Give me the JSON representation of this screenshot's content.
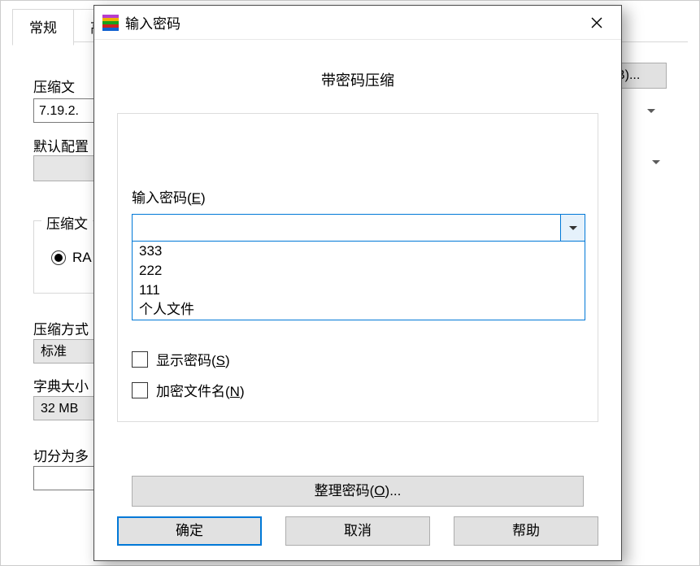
{
  "background": {
    "tabs": {
      "general": "常规",
      "advanced_partial": "高"
    },
    "filename_label": "压缩文",
    "browse_btn": "(B)...",
    "filename_value": "7.19.2.",
    "profile_label": "默认配置",
    "format_group_legend": "压缩文",
    "format_radio_rar": "RA",
    "method_label": "压缩方式",
    "method_value": "标准",
    "dict_label": "字典大小",
    "dict_value": "32 MB",
    "split_label": "切分为多"
  },
  "dialog": {
    "title": "输入密码",
    "heading": "带密码压缩",
    "password_label_prefix": "输入密码(",
    "password_label_key": "E",
    "password_label_suffix": ")",
    "password_value": "",
    "dropdown_items": [
      "333",
      "222",
      "111",
      "个人文件"
    ],
    "show_password_prefix": "显示密码(",
    "show_password_key": "S",
    "show_password_suffix": ")",
    "encrypt_names_prefix": "加密文件名(",
    "encrypt_names_key": "N",
    "encrypt_names_suffix": ")",
    "organize_prefix": "整理密码(",
    "organize_key": "O",
    "organize_suffix": ")...",
    "ok": "确定",
    "cancel": "取消",
    "help": "帮助"
  }
}
